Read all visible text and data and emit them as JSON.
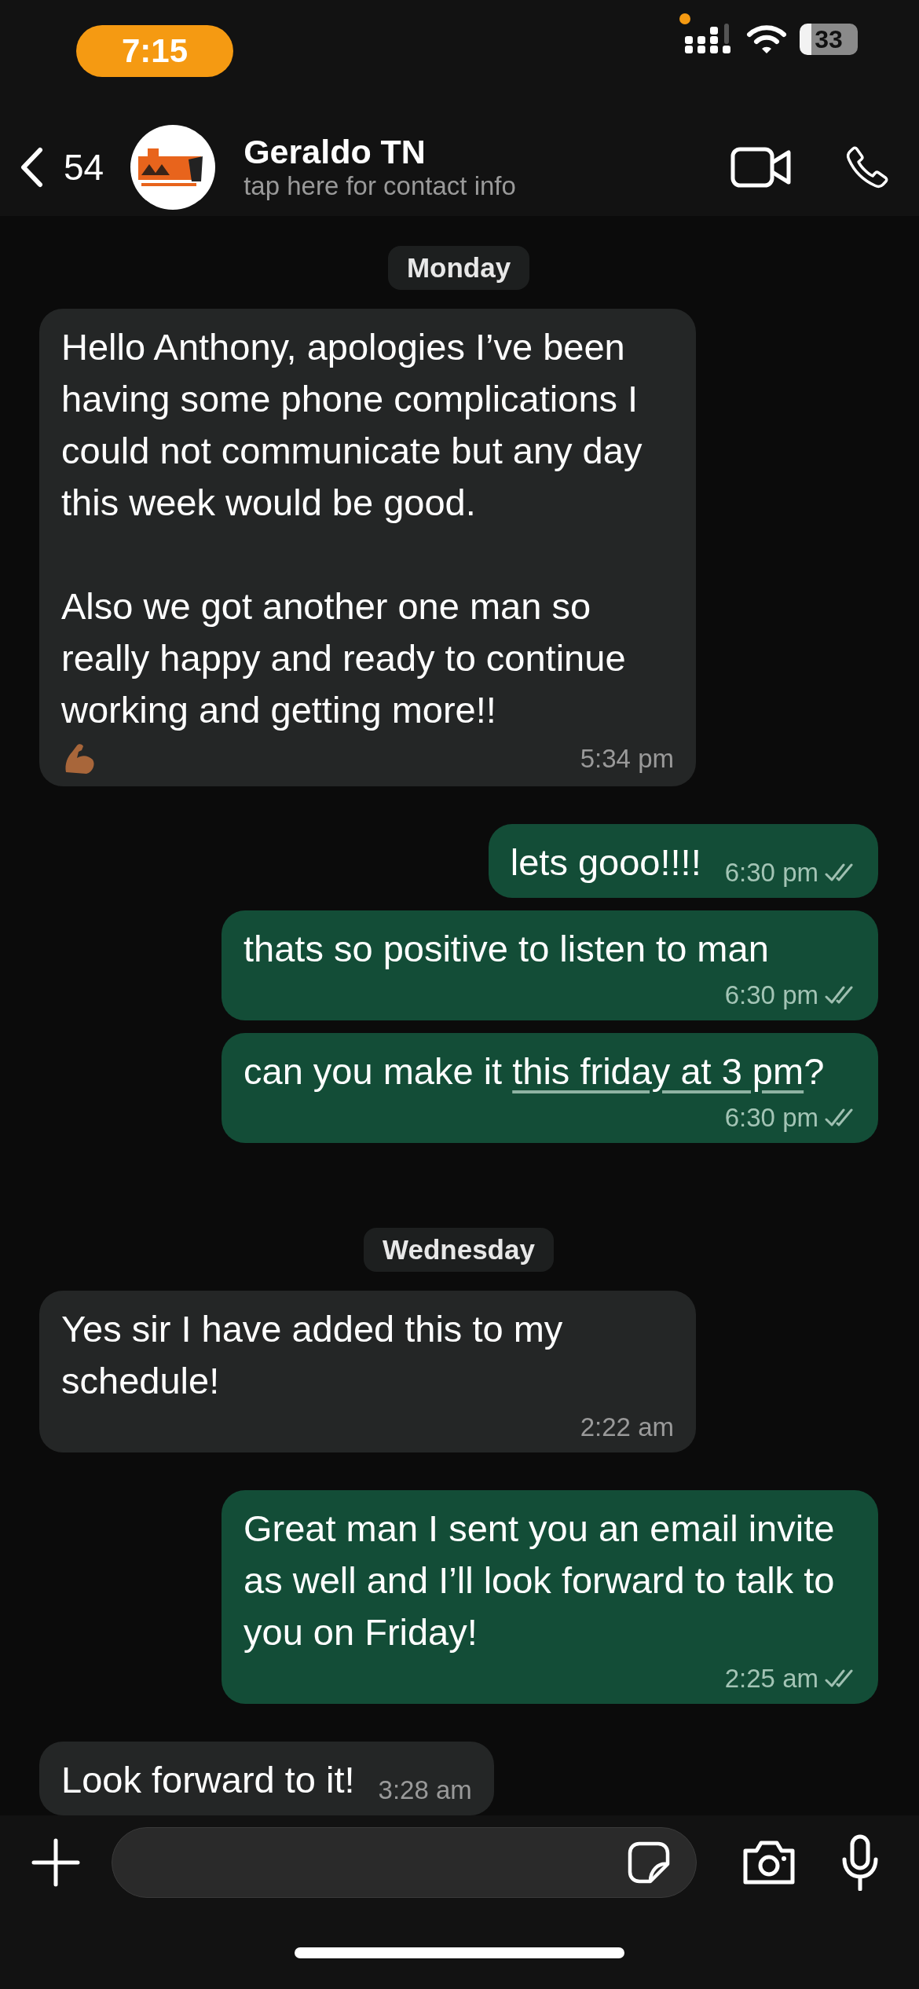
{
  "status_bar": {
    "time": "7:15",
    "battery": "33"
  },
  "header": {
    "back_count": "54",
    "contact_name": "Geraldo TN",
    "subtitle": "tap here for contact info"
  },
  "messages": [
    {
      "kind": "date",
      "text": "Monday"
    },
    {
      "kind": "incoming",
      "text": "Hello Anthony, apologies I’ve been having some phone complications I could not communicate but any day this week would be good.\n\nAlso we got another one man so really happy and ready to continue working and getting more!!",
      "emoji": {
        "kind": "flexed-arm"
      },
      "time": "5:34 pm"
    },
    {
      "kind": "outgoing",
      "text": "lets gooo!!!!",
      "time": "6:30 pm",
      "read": false
    },
    {
      "kind": "outgoing",
      "text": "thats so positive to listen to man",
      "time": "6:30 pm",
      "read": false
    },
    {
      "kind": "outgoing",
      "text": "can you make it ",
      "link": "this friday at 3 pm",
      "text_after": "?",
      "time": "6:30 pm",
      "read": false
    },
    {
      "kind": "date",
      "text": "Wednesday"
    },
    {
      "kind": "incoming",
      "text": "Yes sir I have added this to my schedule!",
      "time": "2:22 am"
    },
    {
      "kind": "outgoing",
      "text": "Great man I sent you an email invite as well and I’ll look forward to talk to you on Friday!",
      "time": "2:25 am",
      "read": false
    },
    {
      "kind": "incoming",
      "text": "Look forward to it!",
      "time": "3:28 am"
    }
  ]
}
